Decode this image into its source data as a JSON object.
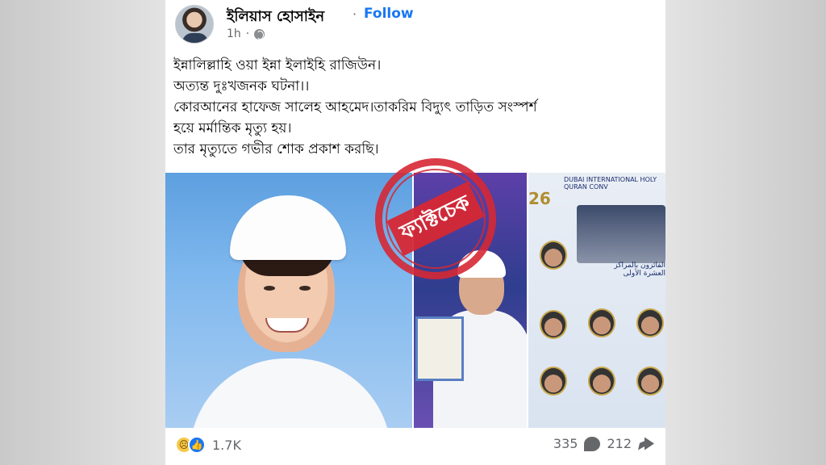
{
  "post": {
    "author": "ইলিয়াস হোসাইন",
    "separator": "·",
    "follow_label": "Follow",
    "time": "1h",
    "privacy_icon": "globe-icon",
    "body_lines": [
      "ইন্নালিল্লাহি ওয়া ইন্না ইলাইহি রাজিউন।",
      "অত্যন্ত দুঃখজনক ঘটনা।।",
      "কোরআনের  হাফেজ সালেহ আহমেদ।তাকরিম বিদ্যুৎ তাড়িত  সংস্পর্শ",
      "হয়ে মর্মান্তিক মৃত্যু হয়।",
      "তার মৃত্যুতে গভীর শোক প্রকাশ করছি।"
    ]
  },
  "stamp": {
    "text": "ফ্যাক্টচেক",
    "color": "#d62834"
  },
  "images": {
    "right_panel": {
      "number": "26",
      "title_text": "DUBAI INTERNATIONAL HOLY QURAN CONV",
      "arabic_heading": "الفائزون بالمراكز العشرة الأولى"
    }
  },
  "footer": {
    "reactions": [
      "sad-emoji",
      "like-emoji"
    ],
    "reaction_count": "1.7K",
    "comments": "335",
    "shares": "212"
  },
  "colors": {
    "follow": "#1877f2",
    "text": "#050505",
    "secondary": "#65676b"
  }
}
